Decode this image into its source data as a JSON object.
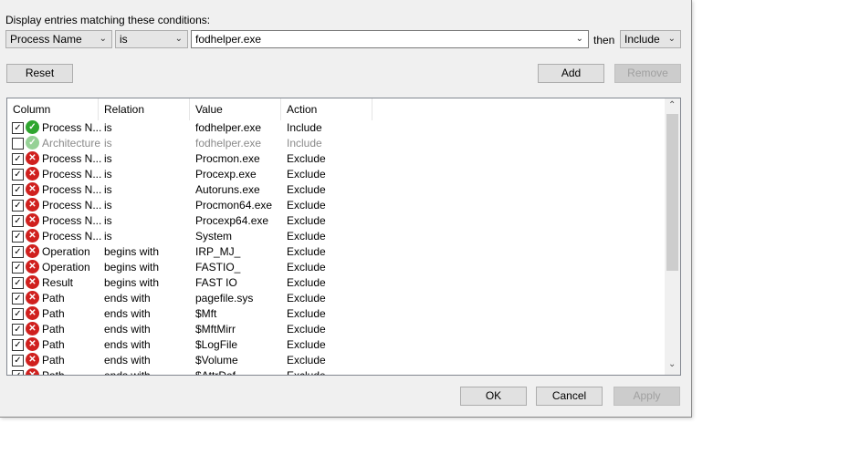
{
  "prompt": "Display entries matching these conditions:",
  "column_select": "Process Name",
  "relation_select": "is",
  "value_input": "fodhelper.exe",
  "then_label": "then",
  "action_select": "Include",
  "buttons": {
    "reset": "Reset",
    "add": "Add",
    "remove": "Remove",
    "ok": "OK",
    "cancel": "Cancel",
    "apply": "Apply"
  },
  "headers": [
    "Column",
    "Relation",
    "Value",
    "Action"
  ],
  "rows": [
    {
      "checked": true,
      "icon": "include",
      "column": "Process N...",
      "relation": "is",
      "value": "fodhelper.exe",
      "action": "Include"
    },
    {
      "checked": false,
      "icon": "include",
      "column": "Architecture",
      "relation": "is",
      "value": "fodhelper.exe",
      "action": "Include"
    },
    {
      "checked": true,
      "icon": "exclude",
      "column": "Process N...",
      "relation": "is",
      "value": "Procmon.exe",
      "action": "Exclude"
    },
    {
      "checked": true,
      "icon": "exclude",
      "column": "Process N...",
      "relation": "is",
      "value": "Procexp.exe",
      "action": "Exclude"
    },
    {
      "checked": true,
      "icon": "exclude",
      "column": "Process N...",
      "relation": "is",
      "value": "Autoruns.exe",
      "action": "Exclude"
    },
    {
      "checked": true,
      "icon": "exclude",
      "column": "Process N...",
      "relation": "is",
      "value": "Procmon64.exe",
      "action": "Exclude"
    },
    {
      "checked": true,
      "icon": "exclude",
      "column": "Process N...",
      "relation": "is",
      "value": "Procexp64.exe",
      "action": "Exclude"
    },
    {
      "checked": true,
      "icon": "exclude",
      "column": "Process N...",
      "relation": "is",
      "value": "System",
      "action": "Exclude"
    },
    {
      "checked": true,
      "icon": "exclude",
      "column": "Operation",
      "relation": "begins with",
      "value": "IRP_MJ_",
      "action": "Exclude"
    },
    {
      "checked": true,
      "icon": "exclude",
      "column": "Operation",
      "relation": "begins with",
      "value": "FASTIO_",
      "action": "Exclude"
    },
    {
      "checked": true,
      "icon": "exclude",
      "column": "Result",
      "relation": "begins with",
      "value": "FAST IO",
      "action": "Exclude"
    },
    {
      "checked": true,
      "icon": "exclude",
      "column": "Path",
      "relation": "ends with",
      "value": "pagefile.sys",
      "action": "Exclude"
    },
    {
      "checked": true,
      "icon": "exclude",
      "column": "Path",
      "relation": "ends with",
      "value": "$Mft",
      "action": "Exclude"
    },
    {
      "checked": true,
      "icon": "exclude",
      "column": "Path",
      "relation": "ends with",
      "value": "$MftMirr",
      "action": "Exclude"
    },
    {
      "checked": true,
      "icon": "exclude",
      "column": "Path",
      "relation": "ends with",
      "value": "$LogFile",
      "action": "Exclude"
    },
    {
      "checked": true,
      "icon": "exclude",
      "column": "Path",
      "relation": "ends with",
      "value": "$Volume",
      "action": "Exclude"
    },
    {
      "checked": true,
      "icon": "exclude",
      "column": "Path",
      "relation": "ends with",
      "value": "$AttrDef",
      "action": "Exclude"
    }
  ]
}
